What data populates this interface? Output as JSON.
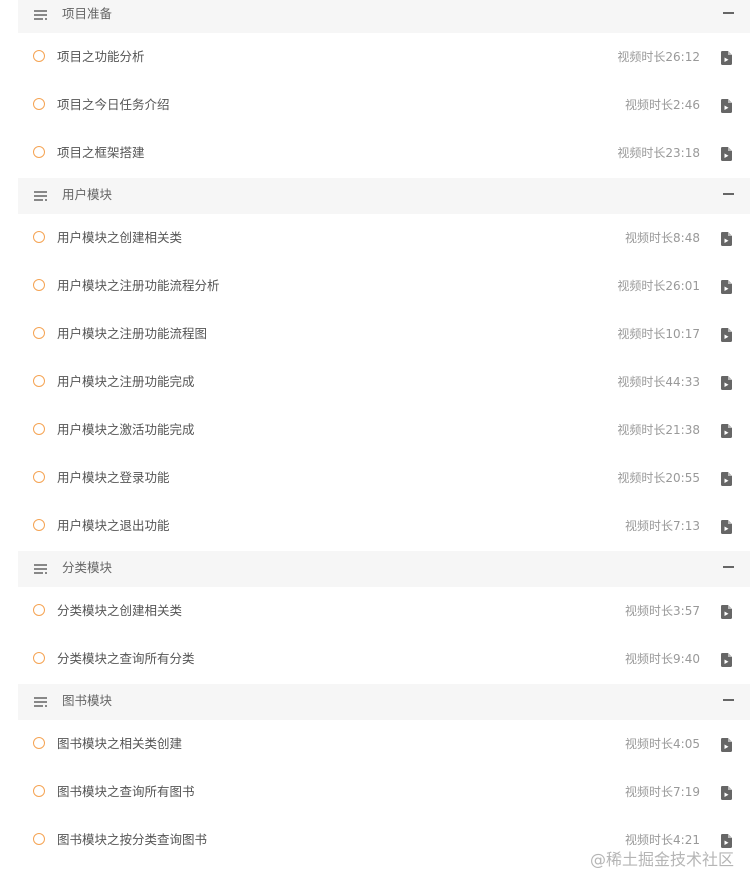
{
  "duration_prefix": "视频时长",
  "sections": [
    {
      "title": "项目准备",
      "lessons": [
        {
          "title": "项目之功能分析",
          "duration": "视频时长26:12"
        },
        {
          "title": "项目之今日任务介绍",
          "duration": "视频时长2:46"
        },
        {
          "title": "项目之框架搭建",
          "duration": "视频时长23:18"
        }
      ]
    },
    {
      "title": "用户模块",
      "lessons": [
        {
          "title": "用户模块之创建相关类",
          "duration": "视频时长8:48"
        },
        {
          "title": "用户模块之注册功能流程分析",
          "duration": "视频时长26:01"
        },
        {
          "title": "用户模块之注册功能流程图",
          "duration": "视频时长10:17"
        },
        {
          "title": "用户模块之注册功能完成",
          "duration": "视频时长44:33"
        },
        {
          "title": "用户模块之激活功能完成",
          "duration": "视频时长21:38"
        },
        {
          "title": "用户模块之登录功能",
          "duration": "视频时长20:55"
        },
        {
          "title": "用户模块之退出功能",
          "duration": "视频时长7:13"
        }
      ]
    },
    {
      "title": "分类模块",
      "lessons": [
        {
          "title": "分类模块之创建相关类",
          "duration": "视频时长3:57"
        },
        {
          "title": "分类模块之查询所有分类",
          "duration": "视频时长9:40"
        }
      ]
    },
    {
      "title": "图书模块",
      "lessons": [
        {
          "title": "图书模块之相关类创建",
          "duration": "视频时长4:05"
        },
        {
          "title": "图书模块之查询所有图书",
          "duration": "视频时长7:19"
        },
        {
          "title": "图书模块之按分类查询图书",
          "duration": "视频时长4:21"
        }
      ]
    }
  ],
  "watermark": "@稀土掘金技术社区",
  "colors": {
    "status_circle": "#f5a454",
    "section_bg": "#f6f6f6",
    "title_text": "#555555",
    "duration_text": "#999999"
  },
  "icons": {
    "section": "menu-lines-icon",
    "collapse": "minus-icon",
    "status": "circle-outline-icon",
    "lesson": "document-icon"
  }
}
